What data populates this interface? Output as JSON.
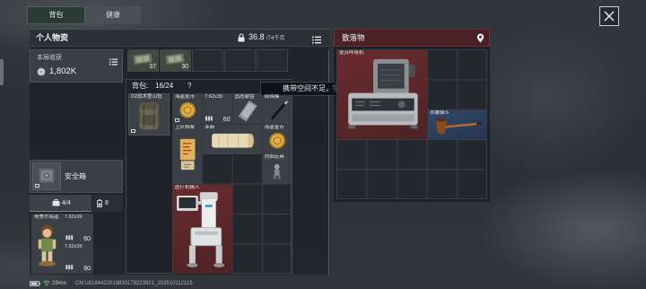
{
  "tabs": [
    {
      "label": "背包",
      "selected": true
    },
    {
      "label": "健康",
      "selected": false
    }
  ],
  "personal": {
    "title": "个人物资",
    "weight_current": "36.8",
    "weight_max": "/74千克"
  },
  "earnings": {
    "title": "本局收获",
    "value": "1,802K",
    "icon": "coin-icon"
  },
  "quick_slots": [
    {
      "count": "37",
      "icon": "bandage-icon"
    },
    {
      "count": "30",
      "icon": "bandage-icon"
    },
    {},
    {},
    {}
  ],
  "backpack": {
    "label": "背包:",
    "capacity": "16/24",
    "help": "?",
    "equipped": {
      "name": "D2战术登山包",
      "icon": "backpack-icon"
    },
    "items": [
      {
        "name": "海盗金币",
        "icon": "coin-icon"
      },
      {
        "name": "7.62x39",
        "count": "60",
        "icon": "ammo-icon"
      },
      {
        "name": "固态硬盘",
        "icon": "ssd-icon"
      },
      {
        "name": "网络模",
        "icon": "module-icon"
      },
      {
        "name": "卫队档案",
        "icon": "document-icon"
      },
      {
        "name": "亚麻",
        "icon": "linen-icon"
      },
      {
        "name": "海盗金币",
        "icon": "coin-icon"
      },
      {
        "name": "烈焰玩具",
        "icon": "toy-icon"
      },
      {
        "name": "医疗机械人",
        "icon": "medical-robot-icon",
        "color": "#5b2629"
      }
    ]
  },
  "tooltip": "携带空间不足，需要容量",
  "safebox": {
    "title": "安全箱",
    "icon": "safe-icon"
  },
  "pouch": {
    "tabs": [
      {
        "label": "4/4",
        "icon": "briefcase-icon"
      },
      {
        "label": "8",
        "icon": "battery-icon"
      }
    ],
    "items": [
      {
        "name": "哥美尔海盗",
        "icon": "figure-icon"
      },
      {
        "name": "7.62x39",
        "count": "60",
        "icon": "ammo-icon"
      },
      {
        "name": "7.62x39",
        "count": "60",
        "icon": "ammo-icon"
      }
    ]
  },
  "loot": {
    "title": "散落物",
    "icon": "location-pin-icon",
    "items": [
      {
        "name": "复苏呼吸机",
        "icon": "resuscitator-icon",
        "color": "#5b2629"
      },
      {
        "name": "木雕烟斗",
        "icon": "pipe-icon",
        "color": "#2b3b55"
      }
    ]
  },
  "status": {
    "ping": "29ms",
    "uid": "CN:U8184422018830178223821_202510112115"
  },
  "colors": {
    "selected_tab": "#2c3a34",
    "loot_header": "#4a2226",
    "rarity_red": "#5b2629",
    "rarity_blue": "#2b3b55",
    "item_gray": "#3b4046",
    "ping_good": "#5fcf6a"
  }
}
